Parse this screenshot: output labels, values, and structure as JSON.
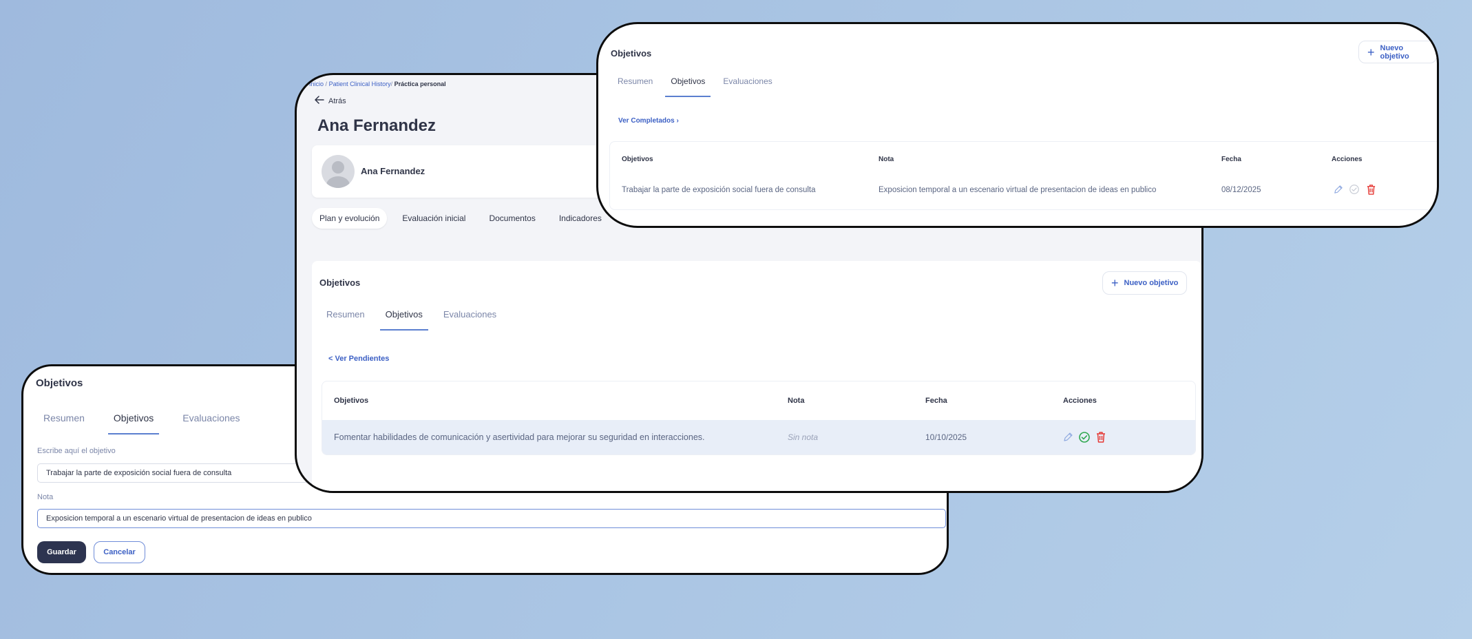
{
  "left": {
    "title": "Objetivos",
    "tabs": [
      "Resumen",
      "Objetivos",
      "Evaluaciones"
    ],
    "objective_label": "Escribe aquí el objetivo",
    "objective_value": "Trabajar la parte de exposición social fuera de consulta",
    "note_label": "Nota",
    "note_value": "Exposicion temporal a un escenario virtual de presentacion de ideas en publico",
    "save_label": "Guardar",
    "cancel_label": "Cancelar"
  },
  "mid": {
    "breadcrumb": {
      "home": "Inicio",
      "sep1": "/",
      "history": "Patient Clinical History",
      "sep2": "/",
      "current": "Práctica personal"
    },
    "back_label": "Atrás",
    "page_title": "Ana Fernandez",
    "patient_name": "Ana Fernandez",
    "main_tabs": [
      "Plan y evolución",
      "Evaluación inicial",
      "Documentos",
      "Indicadores"
    ],
    "section_title": "Objetivos",
    "new_label": "Nuevo objetivo",
    "tabs": [
      "Resumen",
      "Objetivos",
      "Evaluaciones"
    ],
    "toggle_link": "< Ver Pendientes",
    "columns": [
      "Objetivos",
      "Nota",
      "Fecha",
      "Acciones"
    ],
    "row": {
      "objective": "Fomentar habilidades de comunicación y asertividad para mejorar su seguridad en interacciones.",
      "note": "Sin nota",
      "date": "10/10/2025"
    }
  },
  "right": {
    "section_title": "Objetivos",
    "new_label": "Nuevo objetivo",
    "tabs": [
      "Resumen",
      "Objetivos",
      "Evaluaciones"
    ],
    "toggle_link": "Ver Completados ›",
    "columns": [
      "Objetivos",
      "Nota",
      "Fecha",
      "Acciones"
    ],
    "row": {
      "objective": "Trabajar la parte de exposición social fuera de consulta",
      "note": "Exposicion temporal a un escenario virtual de presentacion de ideas en publico",
      "date": "08/12/2025"
    }
  },
  "colors": {
    "accent": "#3b5fc4",
    "primary_button": "#2d3450",
    "success": "#2fa84f",
    "danger": "#e53935",
    "row_highlight": "#e8eef8"
  },
  "icons": [
    "back-arrow-icon",
    "avatar-icon",
    "plus-icon",
    "edit-icon",
    "check-circle-icon",
    "trash-icon"
  ]
}
